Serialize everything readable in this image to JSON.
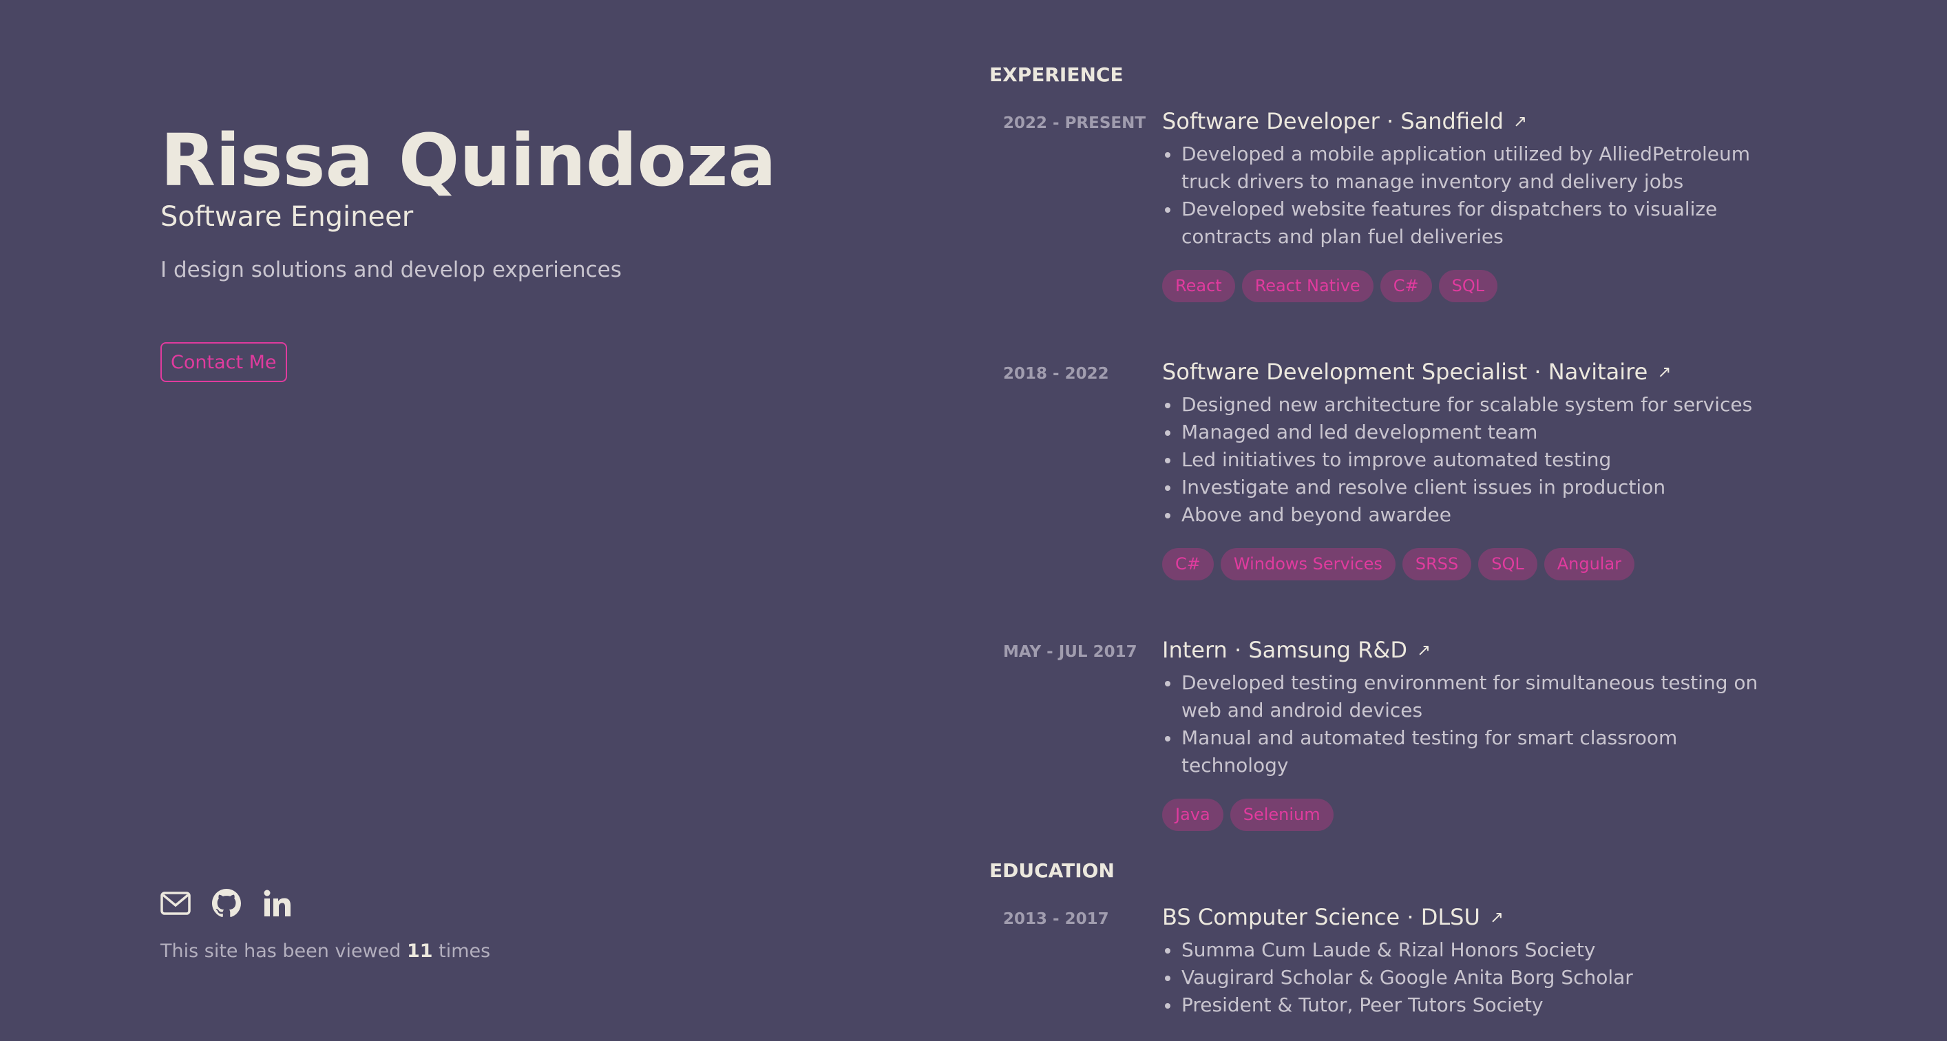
{
  "profile": {
    "name": "Rissa Quindoza",
    "role": "Software Engineer",
    "tagline": "I design solutions and develop experiences",
    "contact_label": "Contact Me"
  },
  "socials": [
    {
      "icon": "mail-icon"
    },
    {
      "icon": "github-icon"
    },
    {
      "icon": "linkedin-icon"
    }
  ],
  "views": {
    "prefix": "This site has been viewed",
    "count": "11",
    "suffix": "times"
  },
  "experience": {
    "title": "EXPERIENCE",
    "items": [
      {
        "date": "2022 - PRESENT",
        "title": "Software Developer · Sandfield",
        "bullets": [
          "Developed a mobile application utilized by AlliedPetroleum truck drivers to manage inventory and delivery jobs",
          "Developed website features for dispatchers to visualize contracts and plan fuel deliveries"
        ],
        "tags": [
          "React",
          "React Native",
          "C#",
          "SQL"
        ]
      },
      {
        "date": "2018 - 2022",
        "title": "Software Development Specialist · Navitaire",
        "bullets": [
          "Designed new architecture for scalable system for services",
          "Managed and led development team",
          "Led initiatives to improve automated testing",
          "Investigate and resolve client issues in production",
          "Above and beyond awardee"
        ],
        "tags": [
          "C#",
          "Windows Services",
          "SRSS",
          "SQL",
          "Angular"
        ]
      },
      {
        "date": "MAY - JUL 2017",
        "title": "Intern · Samsung R&D",
        "bullets": [
          "Developed testing environment for simultaneous testing on web and android devices",
          "Manual and automated testing for smart classroom technology"
        ],
        "tags": [
          "Java",
          "Selenium"
        ]
      }
    ]
  },
  "education": {
    "title": "EDUCATION",
    "items": [
      {
        "date": "2013 - 2017",
        "title": "BS Computer Science · DLSU",
        "bullets": [
          "Summa Cum Laude & Rizal Honors Society",
          "Vaugirard Scholar & Google Anita Borg Scholar",
          "President & Tutor, Peer Tutors Society"
        ]
      }
    ]
  },
  "colors": {
    "background": "#4a4663",
    "accent": "#e03b9e",
    "tag_bg": "#77406f",
    "text": "#ece8de",
    "muted": "#c9c5cf"
  }
}
